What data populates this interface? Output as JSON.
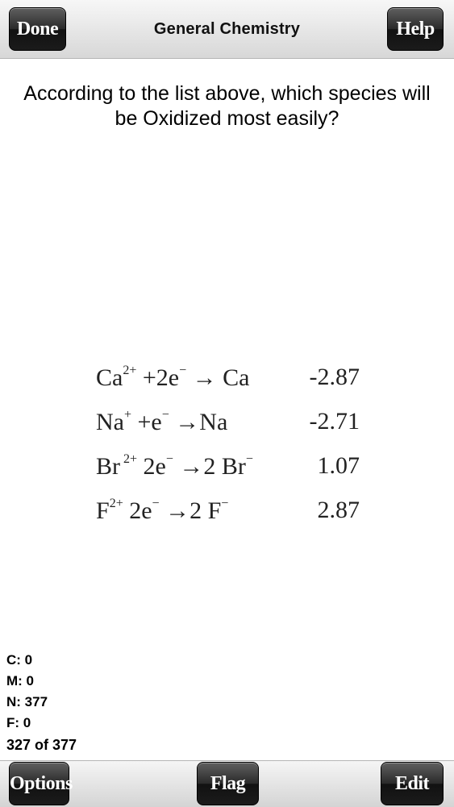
{
  "header": {
    "title": "General Chemistry",
    "done_label": "Done",
    "help_label": "Help"
  },
  "question": {
    "text": "According to the list above, which species will be Oxidized most easily?"
  },
  "figure": {
    "rows": [
      {
        "species": "Ca",
        "charge": "2+",
        "middle": " +2e",
        "electron": "−",
        "product": " → Ca",
        "product_sup": "",
        "value": "-2.87"
      },
      {
        "species": "Na",
        "charge": "+",
        "middle": " +e",
        "electron": "−",
        "product": " →Na",
        "product_sup": "",
        "value": "-2.71"
      },
      {
        "species": "Br",
        "charge": " 2+",
        "middle": " 2e",
        "electron": "−",
        "product": " →2 Br",
        "product_sup": "−",
        "value": "1.07"
      },
      {
        "species": "F",
        "charge": "2+",
        "middle": " 2e",
        "electron": "−",
        "product": "  →2 F",
        "product_sup": "−",
        "value": "2.87"
      }
    ]
  },
  "stats": {
    "c": "C: 0",
    "m": "M: 0",
    "n": "N: 377",
    "f": "F: 0"
  },
  "progress": "327 of 377",
  "footer": {
    "options_label": "Options",
    "flag_label": "Flag",
    "edit_label": "Edit"
  }
}
